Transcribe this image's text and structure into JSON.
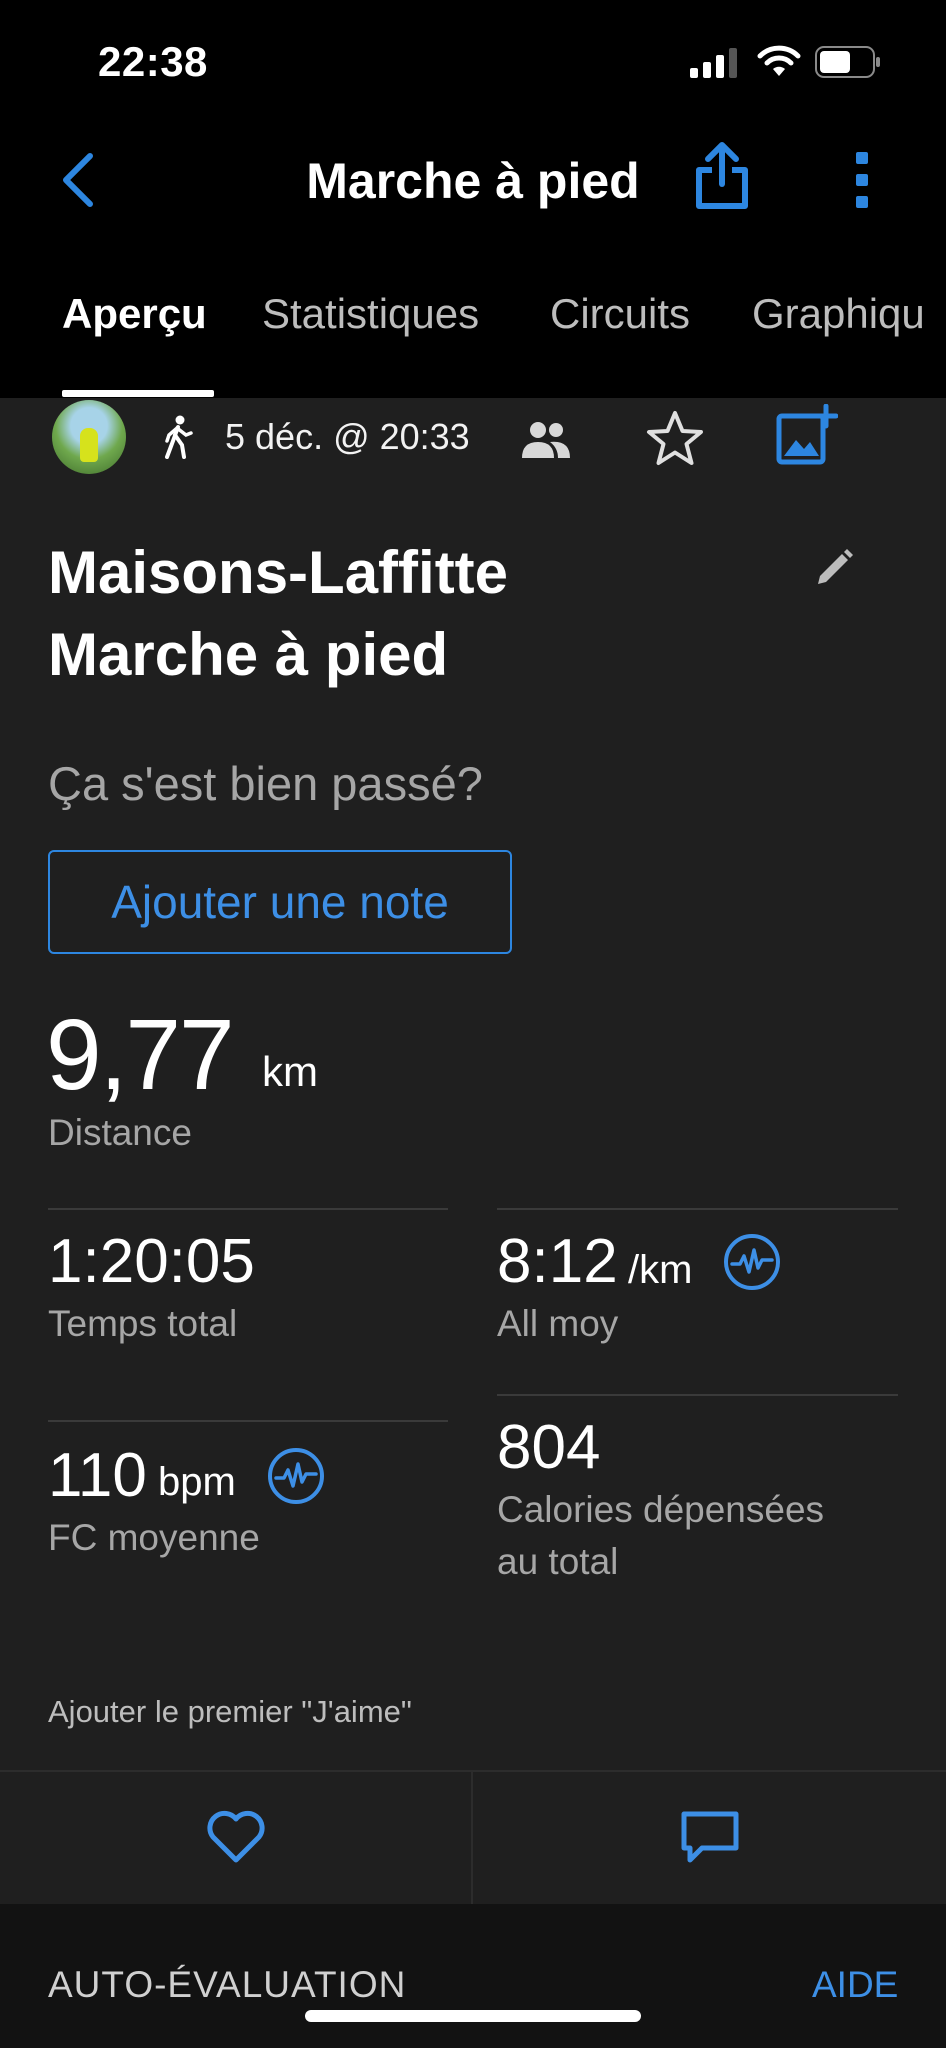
{
  "status_bar": {
    "time": "22:38"
  },
  "nav": {
    "title": "Marche à pied"
  },
  "tabs": [
    {
      "label": "Aperçu"
    },
    {
      "label": "Statistiques"
    },
    {
      "label": "Circuits"
    },
    {
      "label": "Graphiqu"
    }
  ],
  "activity": {
    "date": "5 déc. @ 20:33",
    "title_line1": "Maisons-Laffitte",
    "title_line2": "Marche à pied",
    "question": "Ça s'est bien passé?",
    "add_note_label": "Ajouter une note"
  },
  "distance": {
    "value": "9,77",
    "unit": "km",
    "label": "Distance"
  },
  "stats": {
    "total_time": {
      "value": "1:20:05",
      "label": "Temps total"
    },
    "avg_pace": {
      "value": "8:12",
      "unit": "/km",
      "label": "All moy"
    },
    "avg_hr": {
      "value": "110",
      "unit": "bpm",
      "label": "FC moyenne"
    },
    "calories": {
      "value": "804",
      "label_line1": "Calories dépensées",
      "label_line2": "au total"
    }
  },
  "social": {
    "like_prompt": "Ajouter le premier \"J'aime\""
  },
  "self_evaluation": {
    "title": "AUTO-ÉVALUATION",
    "help": "AIDE"
  },
  "colors": {
    "accent": "#3d8fe6",
    "background": "#1f1f1f",
    "header": "#000000"
  }
}
